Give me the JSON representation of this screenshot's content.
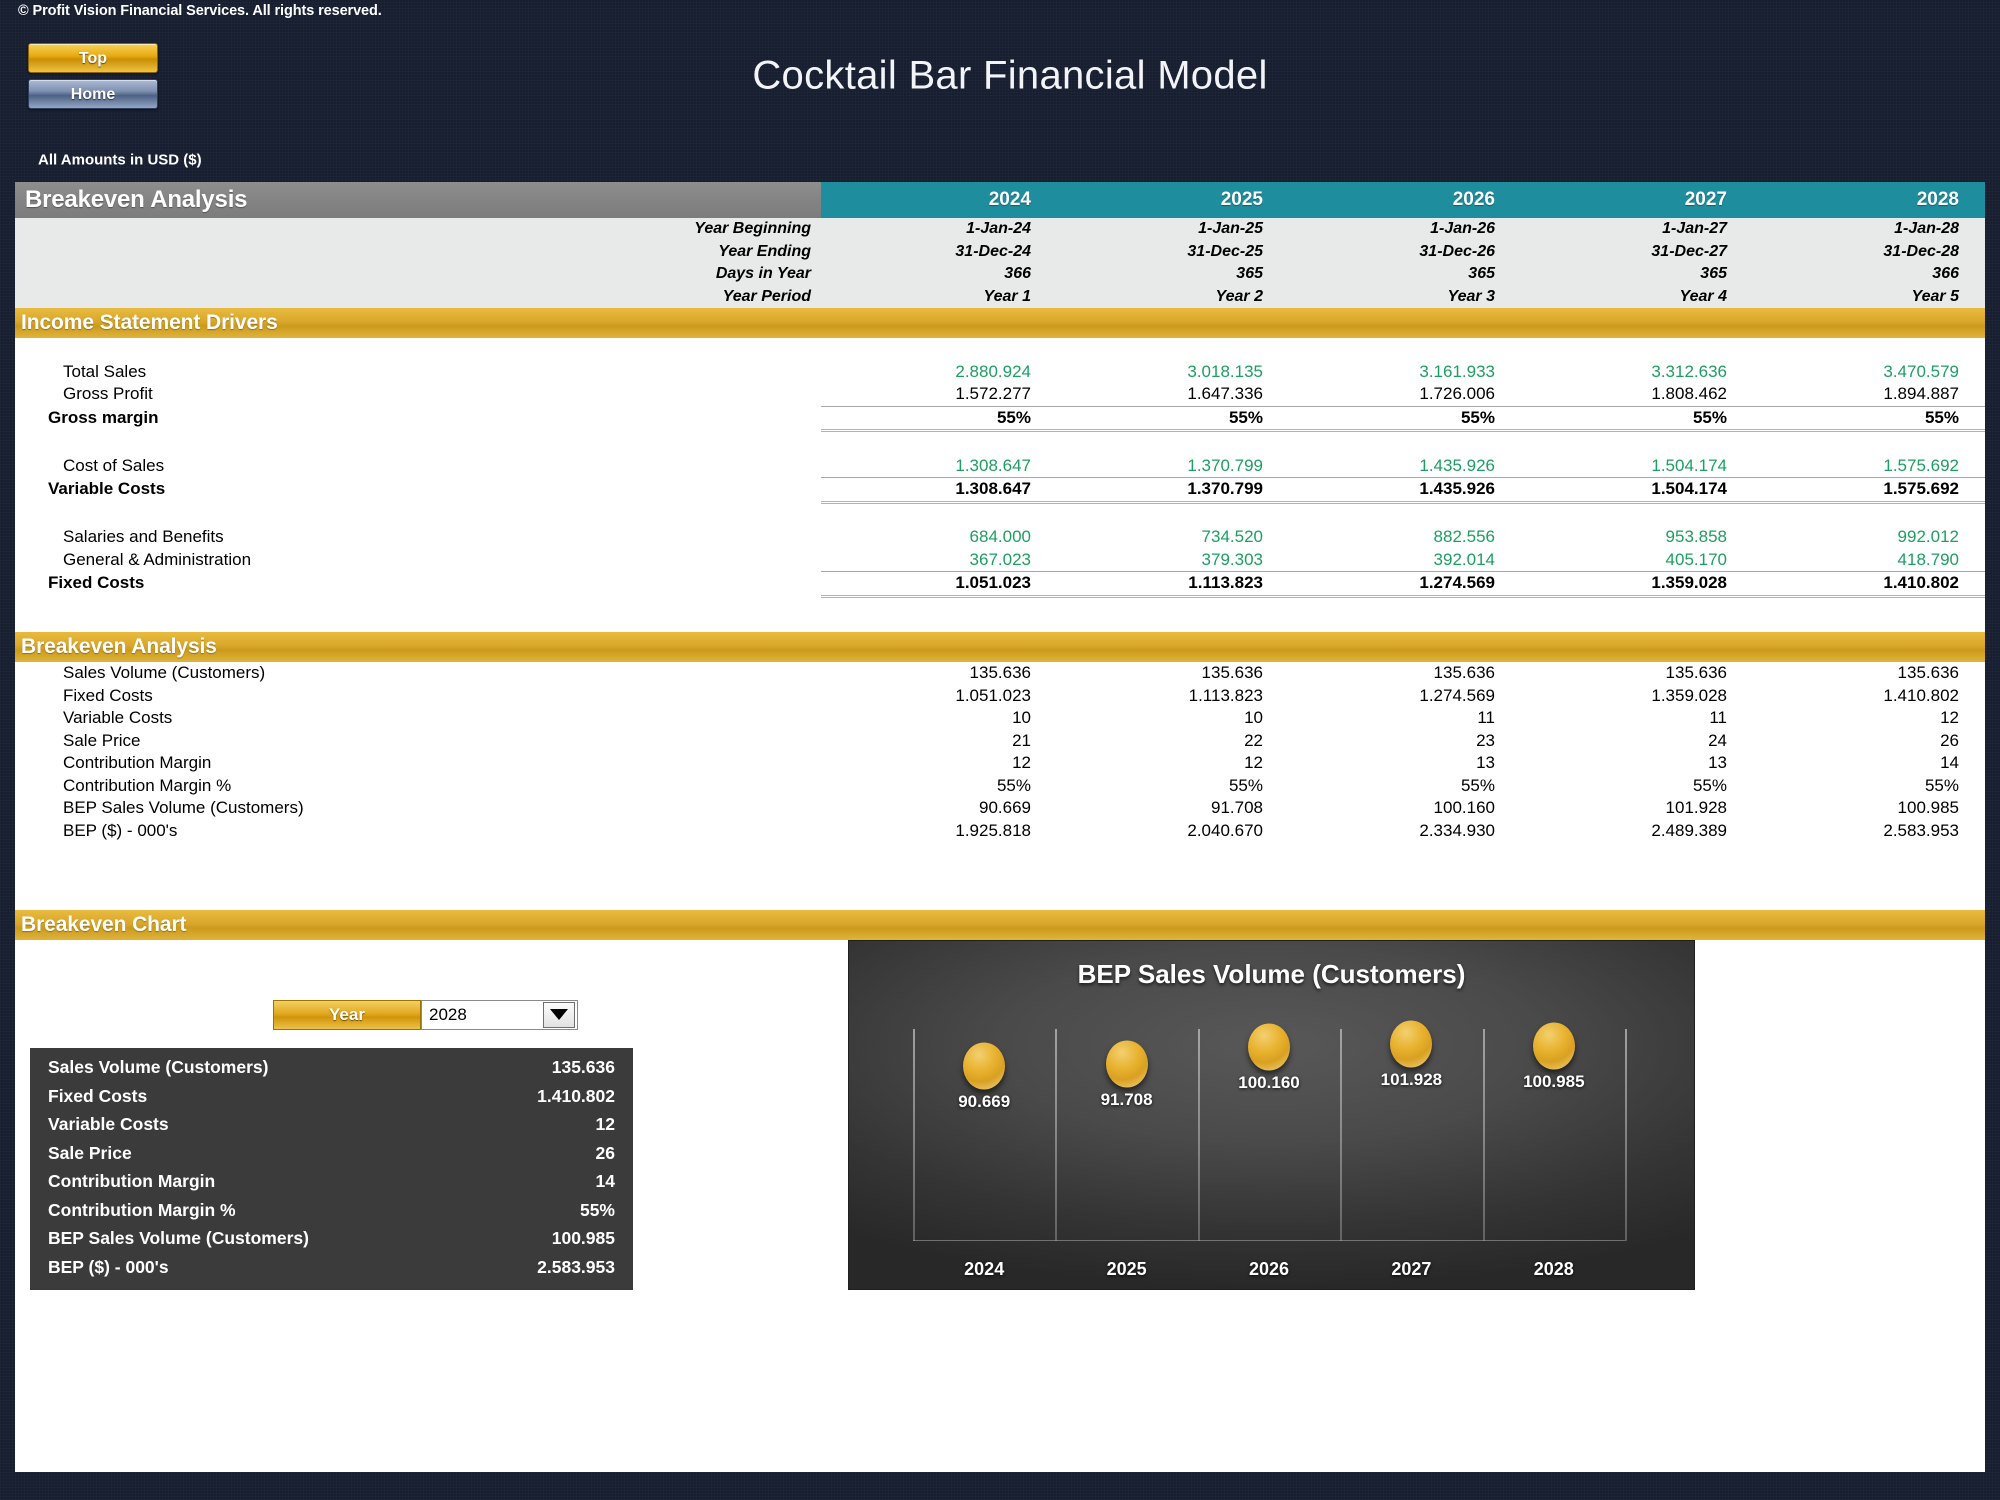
{
  "topbar": {
    "copyright": "© Profit Vision Financial Services. All rights reserved.",
    "top_button": "Top",
    "home_button": "Home",
    "title": "Cocktail Bar Financial Model",
    "amounts_note": "All Amounts in  USD ($)"
  },
  "colors": {
    "background": "#161e30",
    "gold": "#d9a72b",
    "teal": "#1e8e9e",
    "gray_header": "#848484",
    "green_text": "#1e9e62",
    "chart_bg": "#3f3f3f",
    "bubble": "#e8b22e"
  },
  "main_header": {
    "title": "Breakeven Analysis",
    "years": [
      "2024",
      "2025",
      "2026",
      "2027",
      "2028"
    ]
  },
  "date_rows": [
    {
      "label": "Year Beginning",
      "values": [
        "1-Jan-24",
        "1-Jan-25",
        "1-Jan-26",
        "1-Jan-27",
        "1-Jan-28"
      ]
    },
    {
      "label": "Year Ending",
      "values": [
        "31-Dec-24",
        "31-Dec-25",
        "31-Dec-26",
        "31-Dec-27",
        "31-Dec-28"
      ]
    },
    {
      "label": "Days in Year",
      "values": [
        "366",
        "365",
        "365",
        "365",
        "366"
      ]
    },
    {
      "label": "Year Period",
      "values": [
        "Year 1",
        "Year 2",
        "Year 3",
        "Year 4",
        "Year 5"
      ]
    }
  ],
  "income_drivers": {
    "section_title": "Income Statement Drivers",
    "rows": [
      {
        "label": "Total Sales",
        "values": [
          "2.880.924",
          "3.018.135",
          "3.161.933",
          "3.312.636",
          "3.470.579"
        ]
      },
      {
        "label": "Gross Profit",
        "values": [
          "1.572.277",
          "1.647.336",
          "1.726.006",
          "1.808.462",
          "1.894.887"
        ]
      },
      {
        "label": "Gross margin",
        "values": [
          "55%",
          "55%",
          "55%",
          "55%",
          "55%"
        ]
      },
      {
        "label": "Cost of Sales",
        "values": [
          "1.308.647",
          "1.370.799",
          "1.435.926",
          "1.504.174",
          "1.575.692"
        ]
      },
      {
        "label": "Variable Costs",
        "values": [
          "1.308.647",
          "1.370.799",
          "1.435.926",
          "1.504.174",
          "1.575.692"
        ]
      },
      {
        "label": "Salaries and Benefits",
        "values": [
          "684.000",
          "734.520",
          "882.556",
          "953.858",
          "992.012"
        ]
      },
      {
        "label": "General & Administration",
        "values": [
          "367.023",
          "379.303",
          "392.014",
          "405.170",
          "418.790"
        ]
      },
      {
        "label": "Fixed Costs",
        "values": [
          "1.051.023",
          "1.113.823",
          "1.274.569",
          "1.359.028",
          "1.410.802"
        ]
      }
    ]
  },
  "breakeven_analysis": {
    "section_title": "Breakeven Analysis",
    "rows": [
      {
        "label": "Sales Volume (Customers)",
        "values": [
          "135.636",
          "135.636",
          "135.636",
          "135.636",
          "135.636"
        ]
      },
      {
        "label": "Fixed Costs",
        "values": [
          "1.051.023",
          "1.113.823",
          "1.274.569",
          "1.359.028",
          "1.410.802"
        ]
      },
      {
        "label": "Variable Costs",
        "values": [
          "10",
          "10",
          "11",
          "11",
          "12"
        ]
      },
      {
        "label": "Sale Price",
        "values": [
          "21",
          "22",
          "23",
          "24",
          "26"
        ]
      },
      {
        "label": "Contribution Margin",
        "values": [
          "12",
          "12",
          "13",
          "13",
          "14"
        ]
      },
      {
        "label": "Contribution Margin %",
        "values": [
          "55%",
          "55%",
          "55%",
          "55%",
          "55%"
        ]
      },
      {
        "label": "BEP Sales Volume (Customers)",
        "values": [
          "90.669",
          "91.708",
          "100.160",
          "101.928",
          "100.985"
        ]
      },
      {
        "label": "BEP ($) - 000's",
        "values": [
          "1.925.818",
          "2.040.670",
          "2.334.930",
          "2.489.389",
          "2.583.953"
        ]
      }
    ]
  },
  "breakeven_chart": {
    "section_title": "Breakeven Chart",
    "year_button_label": "Year",
    "selected_year": "2028",
    "year_options": [
      "2024",
      "2025",
      "2026",
      "2027",
      "2028"
    ],
    "summary_rows": [
      {
        "label": "Sales Volume (Customers)",
        "value": "135.636"
      },
      {
        "label": "Fixed Costs",
        "value": "1.410.802"
      },
      {
        "label": "Variable Costs",
        "value": "12"
      },
      {
        "label": "Sale Price",
        "value": "26"
      },
      {
        "label": "Contribution Margin",
        "value": "14"
      },
      {
        "label": "Contribution Margin %",
        "value": "55%"
      },
      {
        "label": "BEP Sales Volume (Customers)",
        "value": "100.985"
      },
      {
        "label": "BEP ($) - 000's",
        "value": "2.583.953"
      }
    ]
  },
  "chart_data": {
    "type": "scatter",
    "title": "BEP Sales Volume (Customers)",
    "categories": [
      "2024",
      "2025",
      "2026",
      "2027",
      "2028"
    ],
    "values": [
      90669,
      91708,
      100160,
      101928,
      100985
    ],
    "labels": [
      "90.669",
      "91.708",
      "100.160",
      "101.928",
      "100.985"
    ],
    "xlabel": "",
    "ylabel": "",
    "ylim": [
      0,
      110000
    ],
    "grid": true,
    "legend": "none",
    "marker": "bubble",
    "marker_color": "#e8b22e"
  }
}
